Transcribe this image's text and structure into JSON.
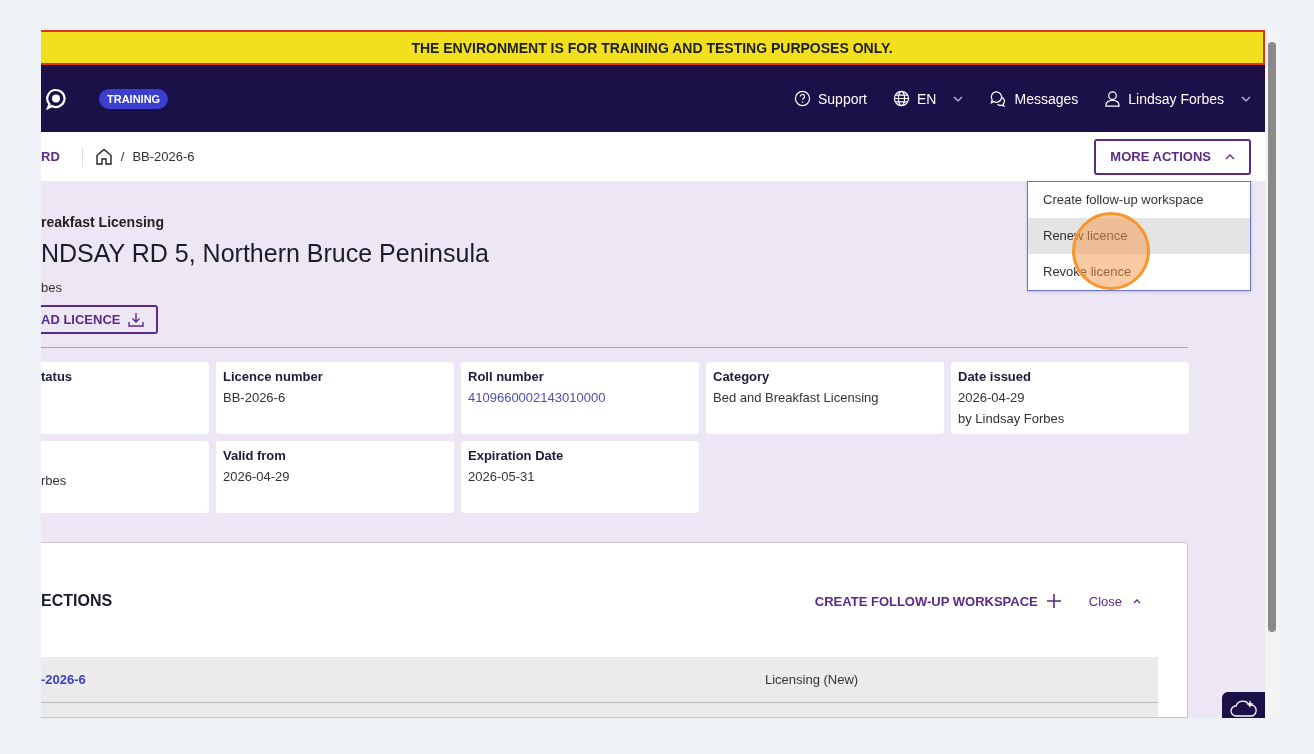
{
  "banner": {
    "text": "THE ENVIRONMENT IS FOR TRAINING AND TESTING PURPOSES ONLY."
  },
  "header": {
    "badge": "TRAINING",
    "nav": [
      {
        "kind": "help",
        "label": "Support",
        "caret": false
      },
      {
        "kind": "language",
        "label": "EN",
        "caret": true
      },
      {
        "kind": "messages",
        "label": "Messages",
        "caret": false
      },
      {
        "kind": "user",
        "label": "Lindsay Forbes",
        "caret": true
      }
    ]
  },
  "breadcrumb": {
    "back": "RD",
    "separator": "/",
    "current": "BB-2026-6"
  },
  "more_actions": {
    "label": "MORE ACTIONS",
    "expanded": true,
    "items": [
      {
        "label": "Create follow-up workspace",
        "selected": false
      },
      {
        "label": "Renew licence",
        "selected": true
      },
      {
        "label": "Revoke licence",
        "selected": false
      }
    ]
  },
  "licence": {
    "type": "reakfast Licensing",
    "address": "NDSAY RD 5, Northern Bruce Peninsula",
    "holder": "bes",
    "download": "AD LICENCE"
  },
  "cards": [
    [
      {
        "label": "tatus"
      },
      {
        "label": "Licence number",
        "value": "BB-2026-6",
        "kind": "text"
      },
      {
        "label": "Roll number",
        "value": "4109660002143010000",
        "kind": "link"
      },
      {
        "label": "Category",
        "value": "Bed and Breakfast Licensing",
        "kind": "text"
      },
      {
        "label": "Date issued",
        "value": "2026-04-29",
        "sub": "by Lindsay Forbes",
        "kind": "text"
      }
    ],
    [
      {
        "value": "rbes",
        "kind": "text"
      },
      {
        "label": "Valid from",
        "value": "2026-04-29",
        "kind": "text"
      },
      {
        "label": "Expiration Date",
        "value": "2026-05-31",
        "kind": "text"
      }
    ]
  ],
  "inspections": {
    "title": "ECTIONS",
    "create": "CREATE FOLLOW-UP WORKSPACE",
    "close": "Close",
    "rows": [
      {
        "column_1": "-2026-6",
        "column_2": "Licensing (New)"
      }
    ]
  }
}
